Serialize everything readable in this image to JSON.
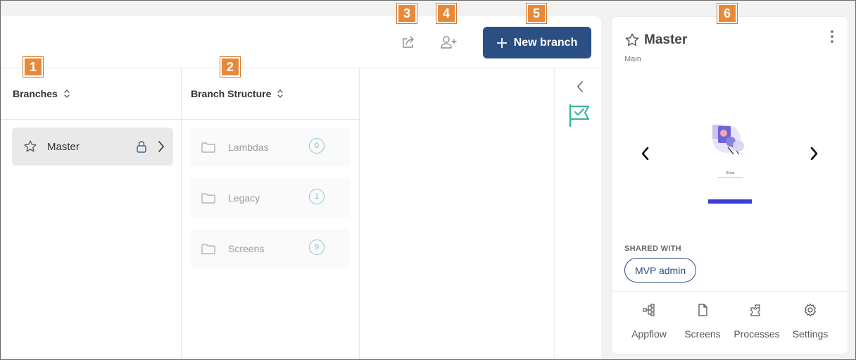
{
  "toolbar": {
    "new_branch_label": "New branch",
    "share_icon": "share-icon",
    "add_user_icon": "add-user-icon"
  },
  "branches_column": {
    "header": "Branches",
    "items": [
      {
        "label": "Master",
        "locked": true
      }
    ]
  },
  "structure_column": {
    "header": "Branch Structure",
    "folders": [
      {
        "label": "Lambdas",
        "count": "0"
      },
      {
        "label": "Legacy",
        "count": "1"
      },
      {
        "label": "Screens",
        "count": "9"
      }
    ]
  },
  "details_panel": {
    "title": "Master",
    "subtitle": "Main",
    "preview_title": "Error",
    "shared_with_label": "SHARED WITH",
    "shared_with": [
      "MVP admin"
    ],
    "tabs": [
      {
        "label": "Appflow",
        "icon": "appflow-icon"
      },
      {
        "label": "Screens",
        "icon": "screens-icon"
      },
      {
        "label": "Processes",
        "icon": "processes-icon"
      },
      {
        "label": "Settings",
        "icon": "gear-icon"
      }
    ]
  },
  "callouts": [
    "1",
    "2",
    "3",
    "4",
    "5",
    "6"
  ],
  "colors": {
    "primary": "#2b4f82",
    "callout": "#e8893a",
    "flag": "#3bb59a",
    "count_ring": "#8fc3dc"
  }
}
